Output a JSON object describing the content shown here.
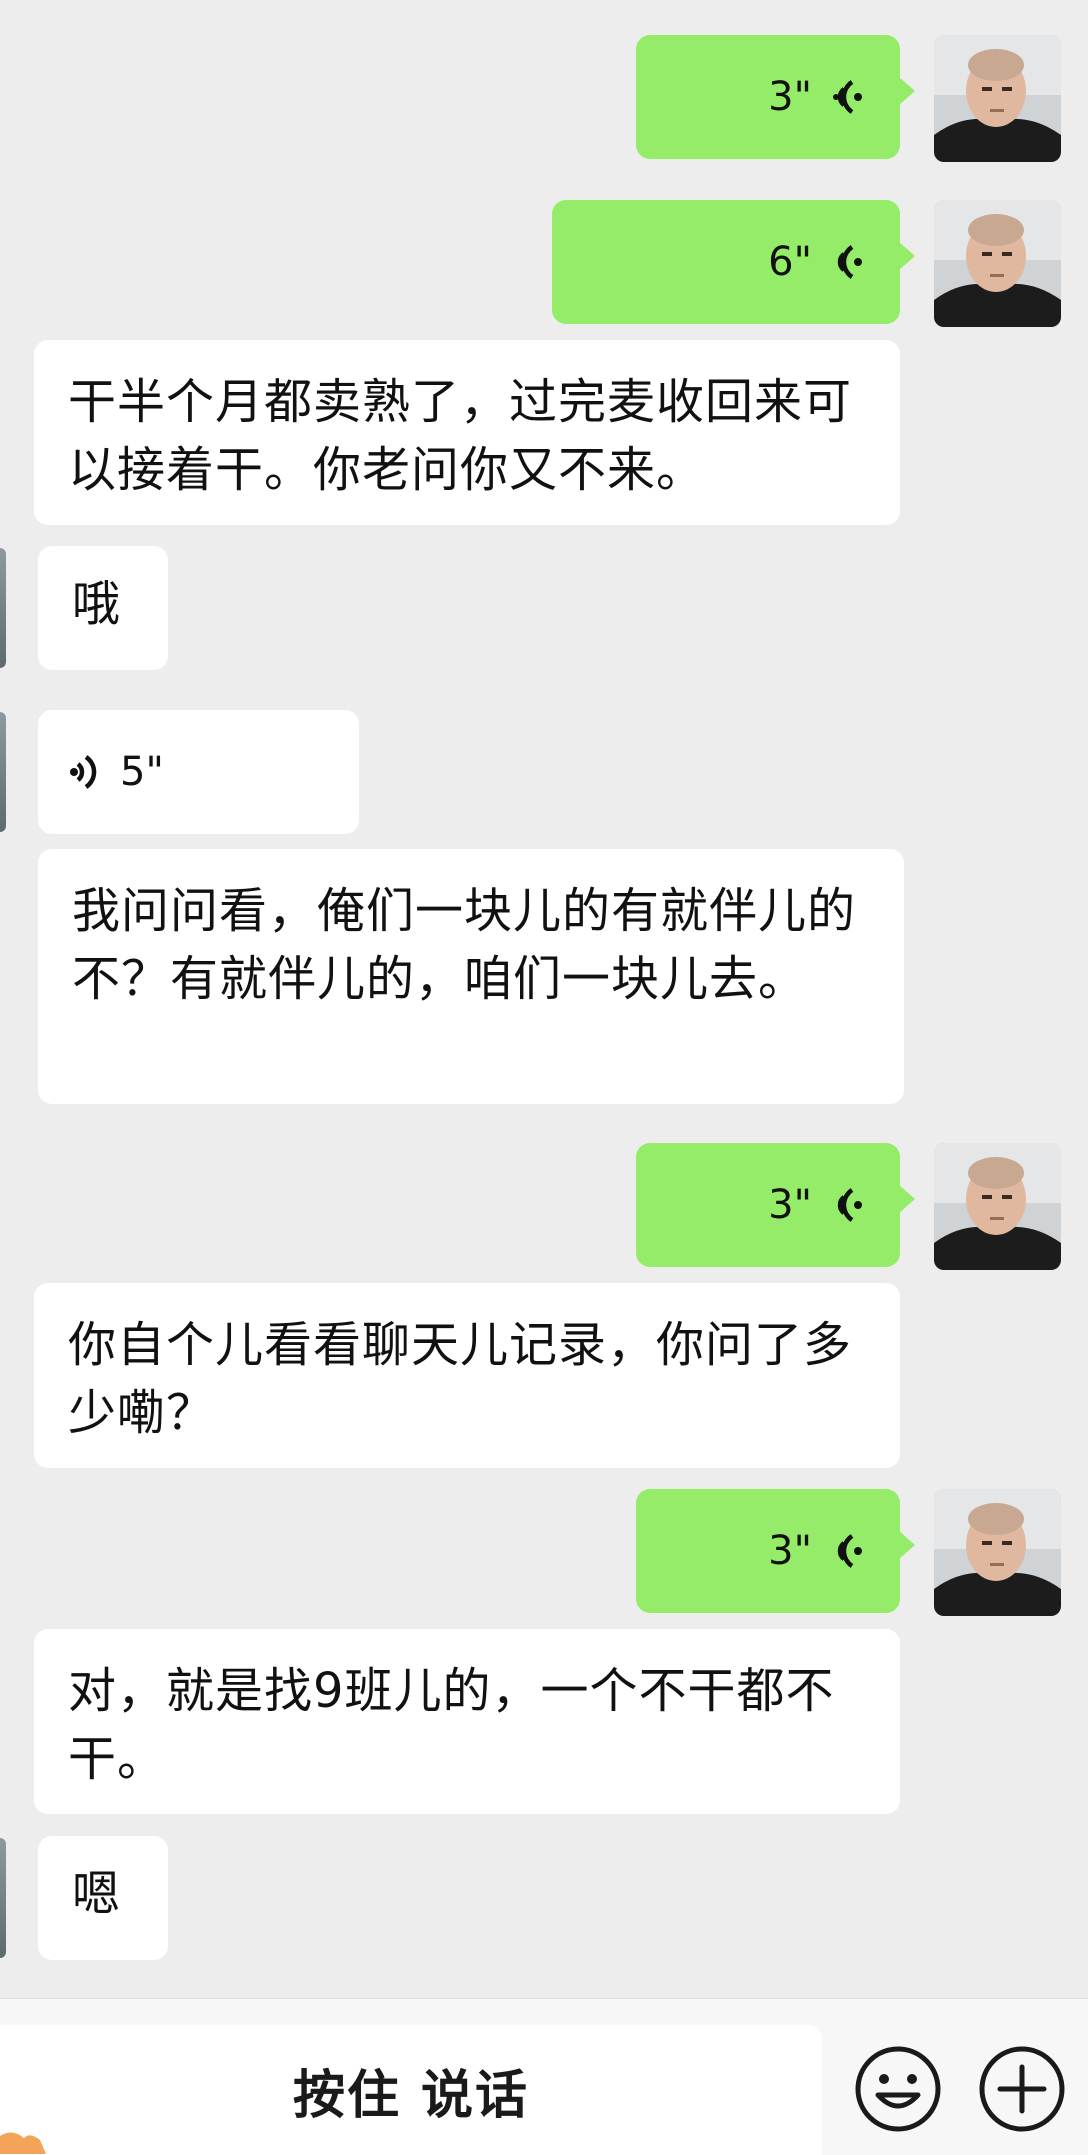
{
  "messages": [
    {
      "side": "me",
      "type": "voice",
      "duration": "3\""
    },
    {
      "side": "me",
      "type": "voice",
      "duration": "6\""
    },
    {
      "side": "other",
      "type": "text",
      "text": "干半个月都卖熟了，过完麦收回来可以接着干。你老问你又不来。"
    },
    {
      "side": "other",
      "type": "text",
      "text": "哦"
    },
    {
      "side": "other",
      "type": "voice",
      "duration": "5\""
    },
    {
      "side": "other",
      "type": "text",
      "text": "我问问看，俺们一块儿的有就伴儿的不？有就伴儿的，咱们一块儿去。"
    },
    {
      "side": "me",
      "type": "voice",
      "duration": "3\""
    },
    {
      "side": "other",
      "type": "text",
      "text": "你自个儿看看聊天儿记录，你问了多少嘞？"
    },
    {
      "side": "me",
      "type": "voice",
      "duration": "3\""
    },
    {
      "side": "other",
      "type": "text",
      "text": "对，就是找9班儿的，一个不干都不干。"
    },
    {
      "side": "other",
      "type": "text",
      "text": "嗯"
    }
  ],
  "footer": {
    "hold_to_talk": "按住 说话",
    "emoji_icon": "smiley-face-icon",
    "more_icon": "plus-circle-icon"
  },
  "colors": {
    "background": "#ededed",
    "my_bubble": "#95ec69",
    "their_bubble": "#ffffff"
  }
}
